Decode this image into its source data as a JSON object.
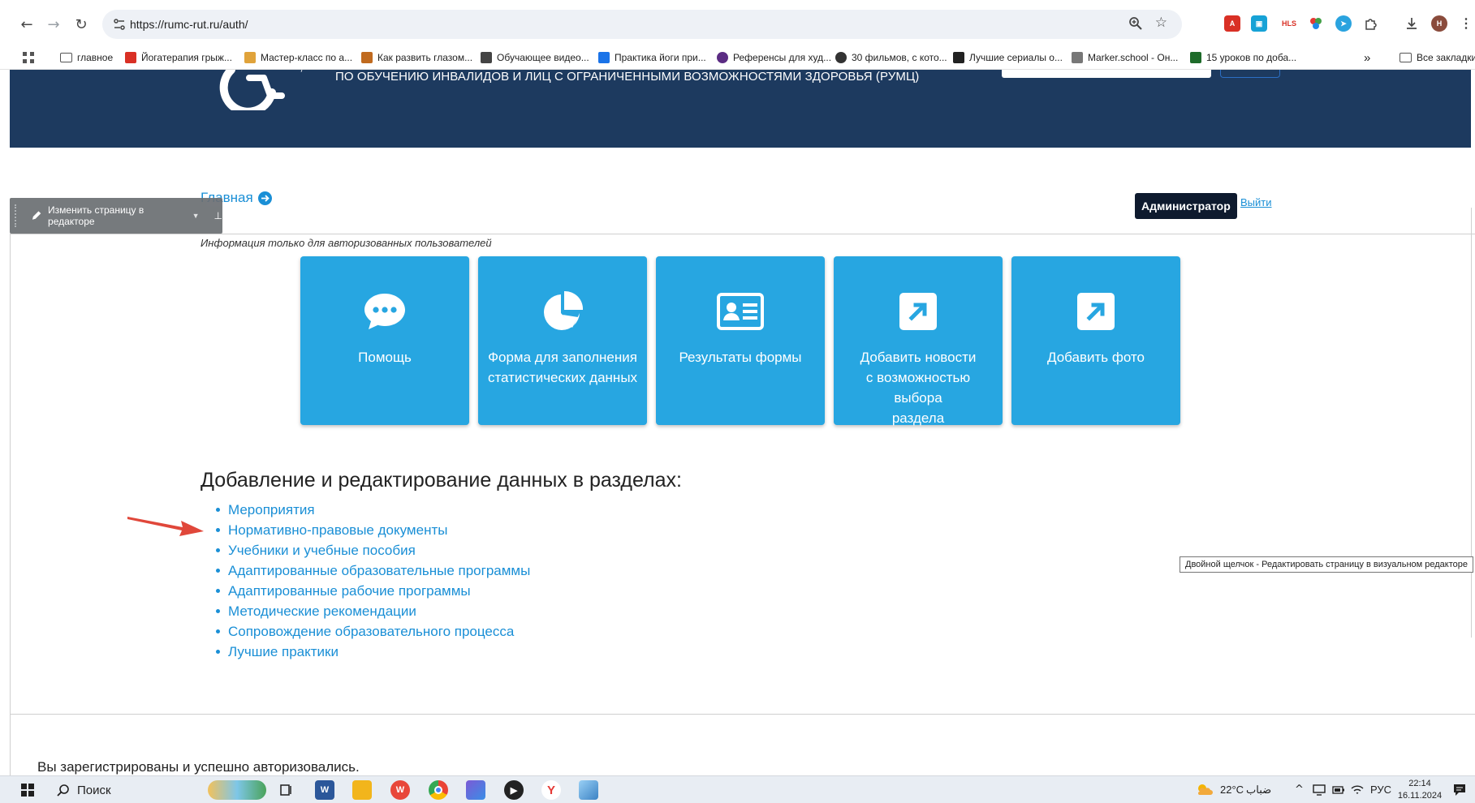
{
  "browser": {
    "url": "https://rumc-rut.ru/auth/",
    "bookmarks": [
      {
        "label": "главное",
        "type": "folder"
      },
      {
        "label": "Йогатерапия грыж...",
        "color": "#d93025"
      },
      {
        "label": "Мастер-класс по а...",
        "color": "#e0a33b"
      },
      {
        "label": "Как развить глазом...",
        "color": "#c06a1f"
      },
      {
        "label": "Обучающее видео...",
        "color": "#444444"
      },
      {
        "label": "Практика йоги при...",
        "color": "#1a73e8"
      },
      {
        "label": "Референсы для худ...",
        "color": "#5b2c83"
      },
      {
        "label": "30 фильмов, с кото...",
        "color": "#333333"
      },
      {
        "label": "Лучшие сериалы о...",
        "color": "#222222"
      },
      {
        "label": "Marker.school - Он...",
        "color": "#777777"
      },
      {
        "label": "15 уроков по доба...",
        "color": "#1e6b2a"
      }
    ],
    "more_bookmarks": "»",
    "all_bookmarks": "Все закладки",
    "extensions": [
      {
        "name": "adblock-extension-icon",
        "label": "ABP",
        "color": "#d93025"
      },
      {
        "name": "screen-extension-icon",
        "label": "",
        "color": "#17a2d6"
      },
      {
        "name": "hls-extension-icon",
        "label": "HLS",
        "color": "#ffffff"
      },
      {
        "name": "puzzle-color-extension-icon",
        "label": "",
        "color": "#2e9e4f"
      },
      {
        "name": "telegram-extension-icon",
        "label": "",
        "color": "#2aa3df"
      }
    ],
    "profile_initial": "Н"
  },
  "site": {
    "header_subtitle": "ПО ОБУЧЕНИЮ ИНВАЛИДОВ И ЛИЦ С ОГРАНИЧЕННЫМИ ВОЗМОЖНОСТЯМИ ЗДОРОВЬЯ (РУМЦ)",
    "breadcrumb": "Главная",
    "editor_bar_label": "Изменить страницу в редакторе",
    "admin_label": "Администратор",
    "logout_label": "Выйти",
    "auth_note": "Информация только для авторизованных пользователей",
    "tiles": [
      {
        "icon": "chat-bubble-icon",
        "label_lines": [
          "Помощь"
        ]
      },
      {
        "icon": "pie-chart-icon",
        "label_lines": [
          "Форма для заполнения",
          "статистических данных"
        ]
      },
      {
        "icon": "id-card-icon",
        "label_lines": [
          "Результаты формы"
        ]
      },
      {
        "icon": "external-link-icon",
        "label_lines": [
          "Добавить новости",
          "с возможностью выбора",
          "раздела"
        ]
      },
      {
        "icon": "external-link-icon",
        "label_lines": [
          "Добавить фото"
        ]
      }
    ],
    "section_heading": "Добавление и редактирование данных в разделах:",
    "sections": [
      "Мероприятия",
      "Нормативно-правовые документы",
      "Учебники и учебные пособия",
      "Адаптированные образовательные программы",
      "Адаптированные рабочие программы",
      "Методические рекомендации",
      "Сопровождение образовательного процесса",
      "Лучшие практики"
    ],
    "tooltip": "Двойной щелчок - Редактировать страницу в визуальном редакторе",
    "success_message": "Вы зарегистрированы и успешно авторизовались.",
    "colors": {
      "header_bg": "#1d3a5f",
      "tile_bg": "#27a6e1",
      "link": "#1a8fd6",
      "arrow": "#e0473a"
    }
  },
  "taskbar": {
    "search_label": "Поиск",
    "weather_temp": "22°C",
    "weather_desc": "ضباب",
    "language": "РУС",
    "time": "22:14",
    "date": "16.11.2024"
  }
}
